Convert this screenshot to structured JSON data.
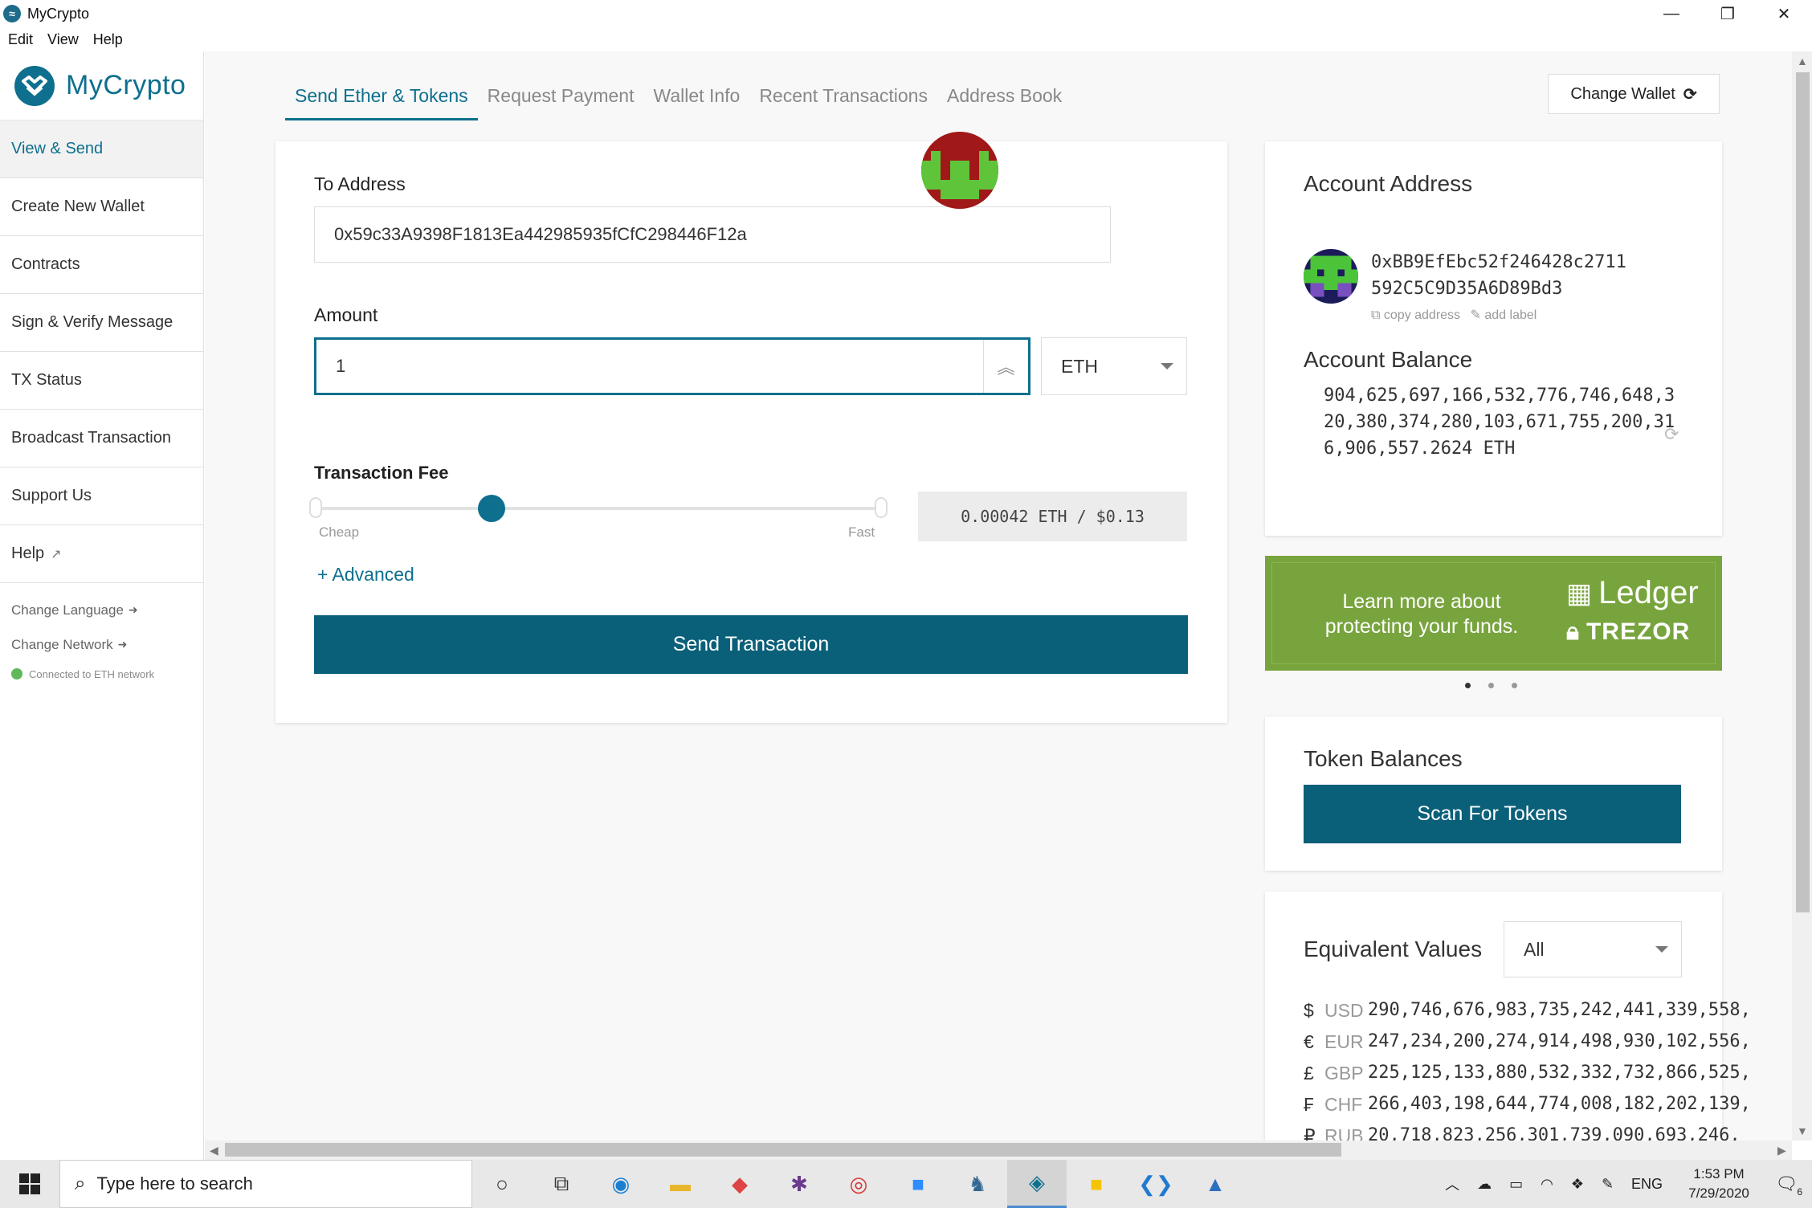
{
  "window": {
    "title": "MyCrypto",
    "menu": [
      "Edit",
      "View",
      "Help"
    ],
    "controls": [
      "—",
      "❐",
      "✕"
    ]
  },
  "sidebar": {
    "logo_text": "MyCrypto",
    "items": [
      {
        "label": "View & Send"
      },
      {
        "label": "Create New Wallet"
      },
      {
        "label": "Contracts"
      },
      {
        "label": "Sign & Verify Message"
      },
      {
        "label": "TX Status"
      },
      {
        "label": "Broadcast Transaction"
      },
      {
        "label": "Support Us"
      },
      {
        "label": "Help"
      }
    ],
    "change_language": "Change Language",
    "change_network": "Change Network",
    "network_status": "Connected to ETH network",
    "status_color": "#5fb85a"
  },
  "tabs": [
    "Send Ether & Tokens",
    "Request Payment",
    "Wallet Info",
    "Recent Transactions",
    "Address Book"
  ],
  "change_wallet": "Change Wallet",
  "send": {
    "to_label": "To Address",
    "to_value": "0x59c33A9398F1813Ea442985935fCfC298446F12a",
    "amount_label": "Amount",
    "amount_value": "1",
    "unit": "ETH",
    "fee_label": "Transaction Fee",
    "fee_level": 0.31,
    "cheap": "Cheap",
    "fast": "Fast",
    "fee_value": "0.00042 ETH / $0.13",
    "advanced": "+ Advanced",
    "send_button": "Send Transaction"
  },
  "account": {
    "title": "Account Address",
    "address_line1": "0xBB9EfEbc52f246428c2711",
    "address_line2": "592C5C9D35A6D89Bd3",
    "copy": "copy address",
    "add_label": "add label",
    "balance_title": "Account Balance",
    "balance": "904,625,697,166,532,776,746,648,320,380,374,280,103,671,755,200,316,906,557.2624 ETH"
  },
  "banner": {
    "text_line1": "Learn more about",
    "text_line2": "protecting your funds.",
    "ledger": "Ledger",
    "trezor": "TREZOR",
    "accent": "#78a43d"
  },
  "tokens": {
    "title": "Token Balances",
    "scan_button": "Scan For Tokens"
  },
  "equivalent": {
    "title": "Equivalent Values",
    "filter": "All",
    "rows": [
      {
        "sym": "$",
        "cur": "USD",
        "val": "290,746,676,983,735,242,441,339,558,"
      },
      {
        "sym": "€",
        "cur": "EUR",
        "val": "247,234,200,274,914,498,930,102,556,"
      },
      {
        "sym": "£",
        "cur": "GBP",
        "val": "225,125,133,880,532,332,732,866,525,"
      },
      {
        "sym": "₣",
        "cur": "CHF",
        "val": "266,403,198,644,774,008,182,202,139,"
      },
      {
        "sym": "₽",
        "cur": "RUB",
        "val": "20,718,823,256,301,739,090,693,246,"
      }
    ]
  },
  "taskbar": {
    "search_placeholder": "Type here to search",
    "lang": "ENG",
    "time": "1:53 PM",
    "date": "7/29/2020",
    "notif_count": "6"
  },
  "colors": {
    "brand": "#0e6f8e",
    "button": "#0b6079"
  }
}
